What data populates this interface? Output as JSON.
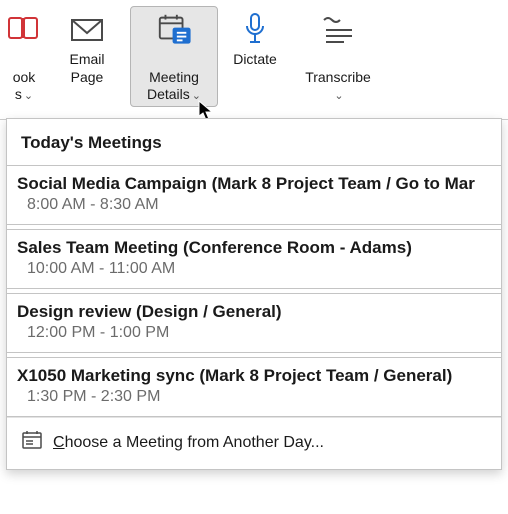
{
  "ribbon": {
    "book": {
      "label": "ook\ns",
      "dropdown": true
    },
    "email_page": {
      "label": "Email\nPage"
    },
    "meeting_details": {
      "label": "Meeting\nDetails",
      "dropdown": true
    },
    "dictate": {
      "label": "Dictate"
    },
    "transcribe": {
      "label": "Transcribe",
      "dropdown": true
    }
  },
  "panel": {
    "header": "Today's Meetings",
    "meetings": [
      {
        "title": "Social Media Campaign (Mark 8 Project Team / Go to Mar",
        "time": "8:00 AM - 8:30 AM"
      },
      {
        "title": "Sales Team Meeting (Conference Room - Adams)",
        "time": "10:00 AM - 11:00 AM"
      },
      {
        "title": "Design review (Design / General)",
        "time": "12:00 PM - 1:00 PM"
      },
      {
        "title": "X1050 Marketing sync (Mark 8 Project Team / General)",
        "time": "1:30 PM - 2:30 PM"
      }
    ],
    "footer_prefix": "C",
    "footer_rest": "hoose a Meeting from Another Day..."
  }
}
